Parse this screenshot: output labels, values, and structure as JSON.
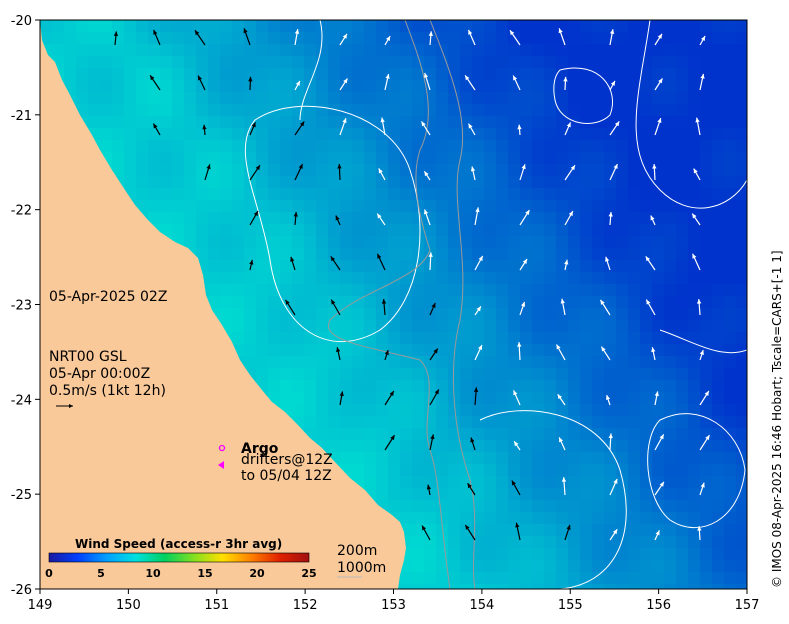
{
  "map": {
    "lon_range": [
      149,
      157
    ],
    "lat_range": [
      -26,
      -20
    ],
    "x_ticks": [
      "149",
      "150",
      "151",
      "152",
      "153",
      "154",
      "155",
      "156",
      "157"
    ],
    "y_ticks": [
      "-20",
      "-21",
      "-22",
      "-23",
      "-24",
      "-25",
      "-26"
    ],
    "land_color": "#f9c99a",
    "ocean_low_color": "#00e6d2",
    "ocean_high_color": "#0033cc"
  },
  "labels": {
    "date": "05-Apr-2025 02Z",
    "product_line1": "NRT00 GSL",
    "product_line2": "05-Apr 00:00Z",
    "product_line3": "0.5m/s (1kt 12h)",
    "argo": "Argo",
    "drifters_line1": "drifters@12Z",
    "drifters_line2": "to 05/04 12Z",
    "depth_200": "200m",
    "depth_1000": "1000m",
    "credit": "© IMOS 08-Apr-2025 16:46 Hobart; Tscale=CARS+[-1 1]"
  },
  "colorbar": {
    "title": "Wind Speed (access-r 3hr avg)",
    "ticks": [
      "0",
      "5",
      "10",
      "15",
      "20",
      "25"
    ],
    "stops": [
      "#1a1aa0",
      "#0040ff",
      "#00a0ff",
      "#00e0e0",
      "#00d060",
      "#80e020",
      "#ffe000",
      "#ff8000",
      "#e02000",
      "#a01010"
    ]
  }
}
